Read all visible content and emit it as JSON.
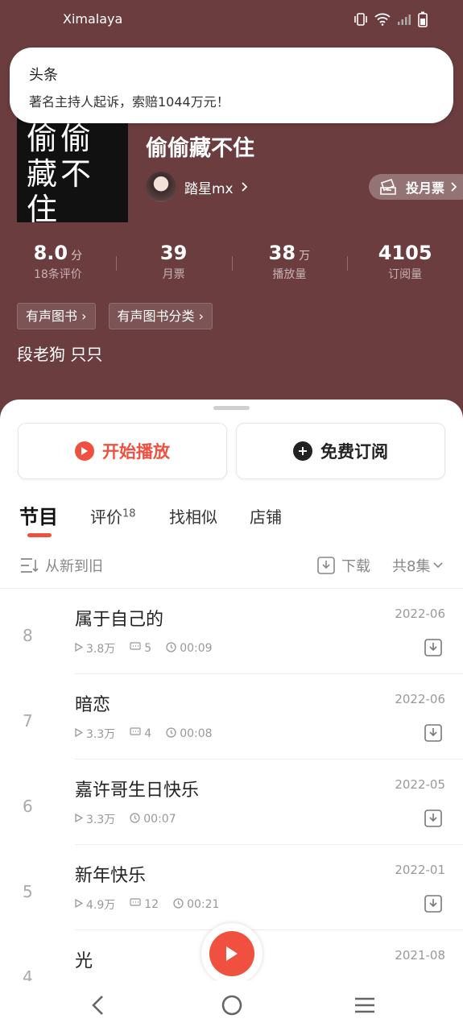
{
  "status_bar": {
    "app_name": "Ximalaya"
  },
  "notification": {
    "title": "头条",
    "body": "著名主持人起诉，索赔1044万元！"
  },
  "album": {
    "cover_text": [
      "偷偷",
      "藏不住"
    ],
    "title": "偷偷藏不住",
    "author": "踏星mx",
    "vote_label": "投月票",
    "stats": [
      {
        "num": "8.0",
        "unit": "分",
        "label": "18条评价"
      },
      {
        "num": "39",
        "unit": "",
        "label": "月票"
      },
      {
        "num": "38",
        "unit": "万",
        "label": "播放量"
      },
      {
        "num": "4105",
        "unit": "",
        "label": "订阅量"
      }
    ],
    "tags": [
      "有声图书",
      "有声图书分类"
    ],
    "description": "段老狗 只只"
  },
  "actions": {
    "play": "开始播放",
    "subscribe": "免费订阅"
  },
  "tabs": [
    {
      "label": "节目",
      "badge": ""
    },
    {
      "label": "评价",
      "badge": "18"
    },
    {
      "label": "找相似",
      "badge": ""
    },
    {
      "label": "店铺",
      "badge": ""
    }
  ],
  "sort": {
    "order": "从新到旧",
    "download": "下载",
    "total": "共8集"
  },
  "episodes": [
    {
      "no": "8",
      "title": "属于自己的",
      "date": "2022-06",
      "plays": "3.8万",
      "comments": "5",
      "duration": "00:09"
    },
    {
      "no": "7",
      "title": "暗恋",
      "date": "2022-06",
      "plays": "3.3万",
      "comments": "4",
      "duration": "00:08"
    },
    {
      "no": "6",
      "title": "嘉许哥生日快乐",
      "date": "2022-05",
      "plays": "3.3万",
      "comments": "",
      "duration": "00:07"
    },
    {
      "no": "5",
      "title": "新年快乐",
      "date": "2022-01",
      "plays": "4.9万",
      "comments": "12",
      "duration": "00:21"
    },
    {
      "no": "4",
      "title": "光",
      "date": "2021-08",
      "plays": "",
      "comments": "",
      "duration": ""
    }
  ],
  "colors": {
    "accent": "#f0503f",
    "header_bg": "#6b3d3f"
  }
}
